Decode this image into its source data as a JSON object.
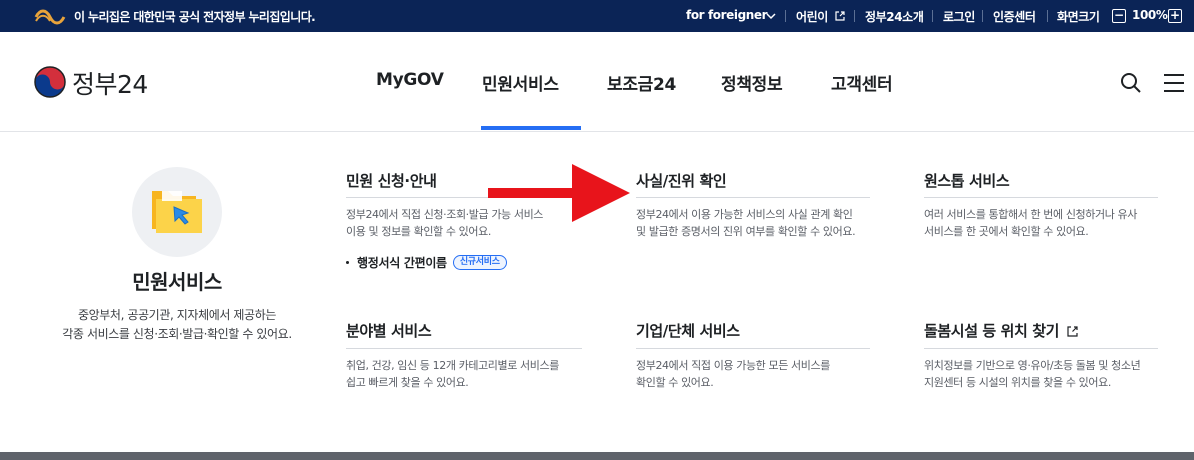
{
  "topbar": {
    "notice": "이 누리집은 대한민국 공식 전자정부 누리집입니다.",
    "links": [
      "for foreigner",
      "어린이",
      "정부24소개",
      "로그인",
      "인증센터",
      "화면크기"
    ],
    "zoom_level": "100%",
    "zoom_minus": "−",
    "zoom_plus": "+"
  },
  "header": {
    "logo_text": "정부24",
    "nav": [
      "MyGOV",
      "민원서비스",
      "보조금24",
      "정책정보",
      "고객센터"
    ],
    "active_nav": "민원서비스"
  },
  "menu": {
    "title": "민원서비스",
    "desc_line1": "중앙부처, 공공기관, 지자체에서 제공하는",
    "desc_line2": "각종 서비스를 신청·조회·발급·확인할 수 있어요.",
    "sections": [
      {
        "title": "민원 신청·안내",
        "desc1": "정부24에서 직접 신청·조회·발급 가능 서비스",
        "desc2": "이용 및 정보를 확인할 수 있어요."
      },
      {
        "title": "사실/진위 확인",
        "desc1": "정부24에서 이용 가능한 서비스의 사실 관계 확인",
        "desc2": "및 발급한 증명서의 진위 여부를 확인할 수 있어요."
      },
      {
        "title": "원스톱 서비스",
        "desc1": "여러 서비스를 통합해서 한 번에 신청하거나 유사",
        "desc2": "서비스를 한 곳에서 확인할 수 있어요."
      },
      {
        "title": "분야별 서비스",
        "desc1": "취업, 건강, 임신 등 12개 카테고리별로 서비스를",
        "desc2": "쉽고 빠르게 찾을 수 있어요."
      },
      {
        "title": "기업/단체 서비스",
        "desc1": "정부24에서 직접 이용 가능한 모든 서비스를",
        "desc2": "확인할 수 있어요."
      },
      {
        "title": "돌봄시설 등 위치 찾기",
        "desc1": "위치정보를 기반으로 영·유아/초등 돌봄 및 청소년",
        "desc2": "지원센터 등 시설의 위치를 찾을 수 있어요."
      }
    ],
    "sub_link": "행정서식 간편이름",
    "sub_badge": "신규서비스"
  },
  "colors": {
    "topbar": "#0b2456",
    "accent": "#256ef4",
    "arrow": "#e8141b"
  }
}
